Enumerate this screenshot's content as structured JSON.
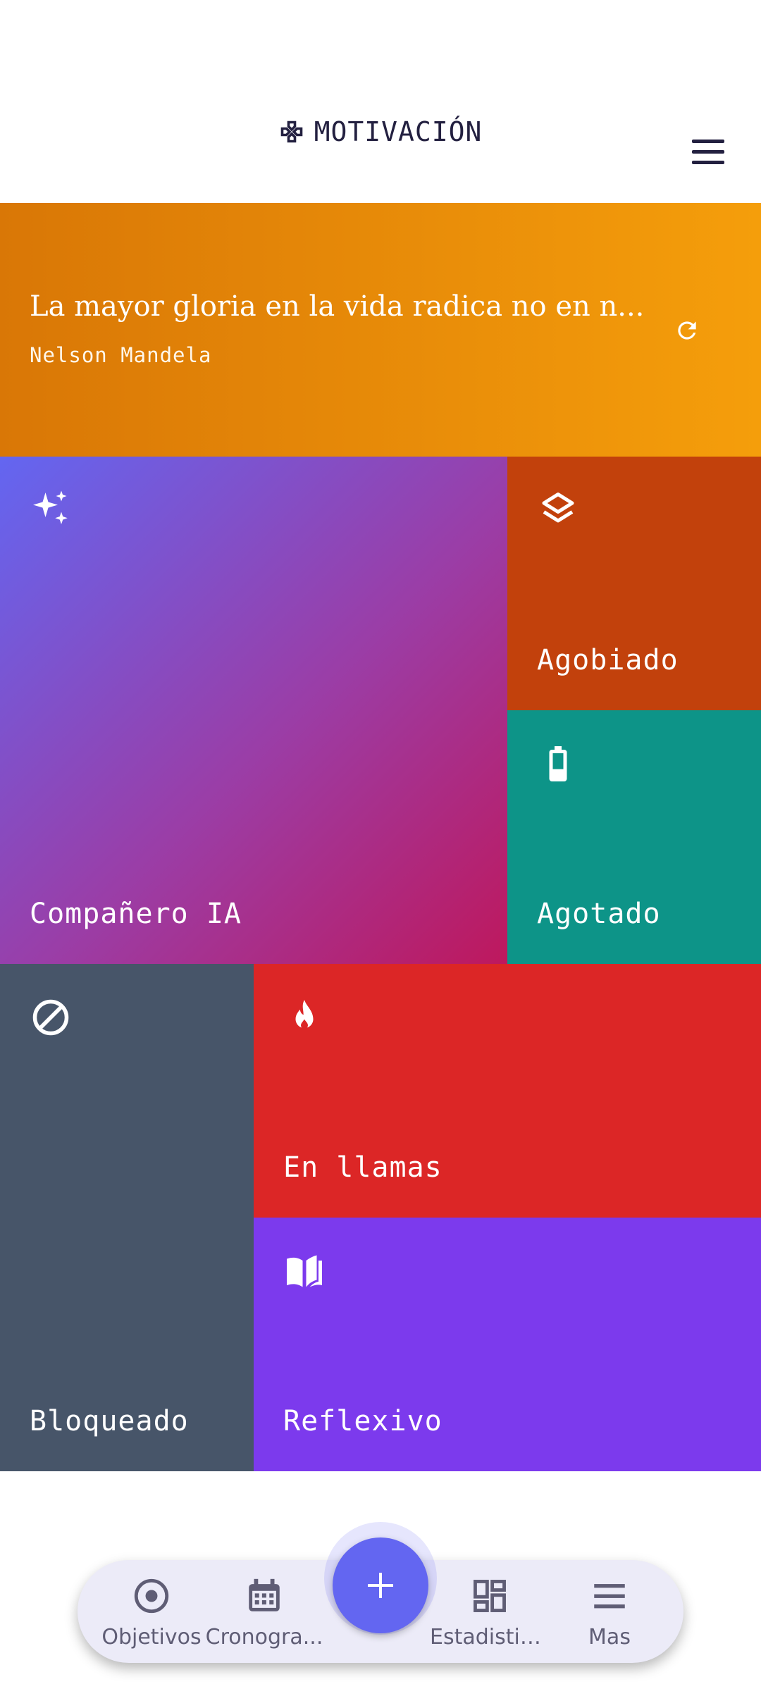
{
  "header": {
    "title": "MOTIVACIÓN",
    "title_icon": "gamepad-icon",
    "menu_icon": "hamburger-menu-icon"
  },
  "quote": {
    "text": "La mayor gloria en la vida radica no en n...",
    "author": "Nelson Mandela",
    "refresh_icon": "refresh-icon"
  },
  "tiles": [
    {
      "label": "Compañero IA",
      "icon": "sparkles-icon",
      "color": "#6366f1"
    },
    {
      "label": "Agobiado",
      "icon": "layers-icon",
      "color": "#c2410c"
    },
    {
      "label": "Agotado",
      "icon": "battery-icon",
      "color": "#0d9488"
    },
    {
      "label": "Bloqueado",
      "icon": "blocked-icon",
      "color": "#475569"
    },
    {
      "label": "En llamas",
      "icon": "flame-icon",
      "color": "#dc2626"
    },
    {
      "label": "Reflexivo",
      "icon": "book-icon",
      "color": "#7c3aed"
    }
  ],
  "nav": {
    "items": [
      {
        "label": "Objetivos",
        "icon": "target-icon"
      },
      {
        "label": "Cronogra...",
        "icon": "calendar-icon"
      },
      {
        "label": "Estadistic...",
        "icon": "dashboard-icon"
      },
      {
        "label": "Mas",
        "icon": "menu-icon"
      }
    ],
    "fab_icon": "plus-icon",
    "accent": "#6366f1"
  }
}
